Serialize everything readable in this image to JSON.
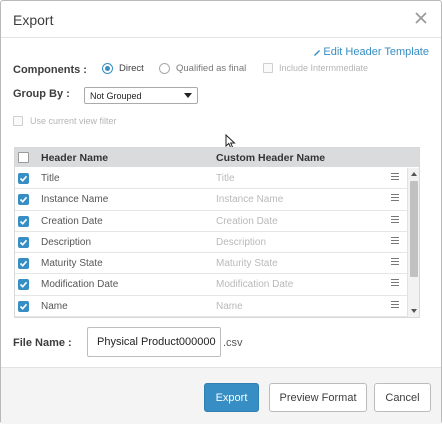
{
  "dialog": {
    "title": "Export",
    "edit_link": "Edit Header Template"
  },
  "components": {
    "label": "Components :",
    "options": [
      {
        "label": "Direct",
        "checked": true
      },
      {
        "label": "Qualified as final",
        "checked": false
      }
    ],
    "include_label": "Include Intermmediate"
  },
  "group_by": {
    "label": "Group By :",
    "selected": "Not Grouped"
  },
  "filter": {
    "label": "Use current view filter"
  },
  "table": {
    "headers": [
      "Header Name",
      "Custom Header Name"
    ],
    "rows": [
      {
        "name": "Title",
        "custom": "Title"
      },
      {
        "name": "Instance Name",
        "custom": "Instance Name"
      },
      {
        "name": "Creation Date",
        "custom": "Creation Date"
      },
      {
        "name": "Description",
        "custom": "Description"
      },
      {
        "name": "Maturity State",
        "custom": "Maturity State"
      },
      {
        "name": "Modification Date",
        "custom": "Modification Date"
      },
      {
        "name": "Name",
        "custom": "Name"
      }
    ]
  },
  "file": {
    "label": "File Name :",
    "value": "Physical Product000000",
    "extension": ".csv"
  },
  "buttons": {
    "export": "Export",
    "preview": "Preview Format",
    "cancel": "Cancel"
  },
  "colors": {
    "accent": "#368ec4",
    "header_bg": "#dadbdd",
    "footer_bg": "#f4f4f4"
  }
}
